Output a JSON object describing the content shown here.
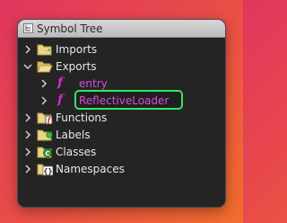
{
  "window": {
    "title": "Symbol Tree"
  },
  "tree": {
    "items": [
      {
        "label": "Imports"
      },
      {
        "label": "Exports"
      },
      {
        "label": "entry"
      },
      {
        "label": "ReflectiveLoader"
      },
      {
        "label": "Functions"
      },
      {
        "label": "Labels"
      },
      {
        "label": "Classes"
      },
      {
        "label": "Namespaces"
      }
    ]
  },
  "colors": {
    "highlight": "#39e26a",
    "function_symbol": "#d42bd1",
    "panel_background": "#242424"
  },
  "icons": [
    "tree-icon",
    "chevron-right-icon",
    "chevron-down-icon",
    "folder-closed-icon",
    "folder-open-icon",
    "function-icon",
    "label-icon",
    "class-icon",
    "namespace-icon"
  ]
}
